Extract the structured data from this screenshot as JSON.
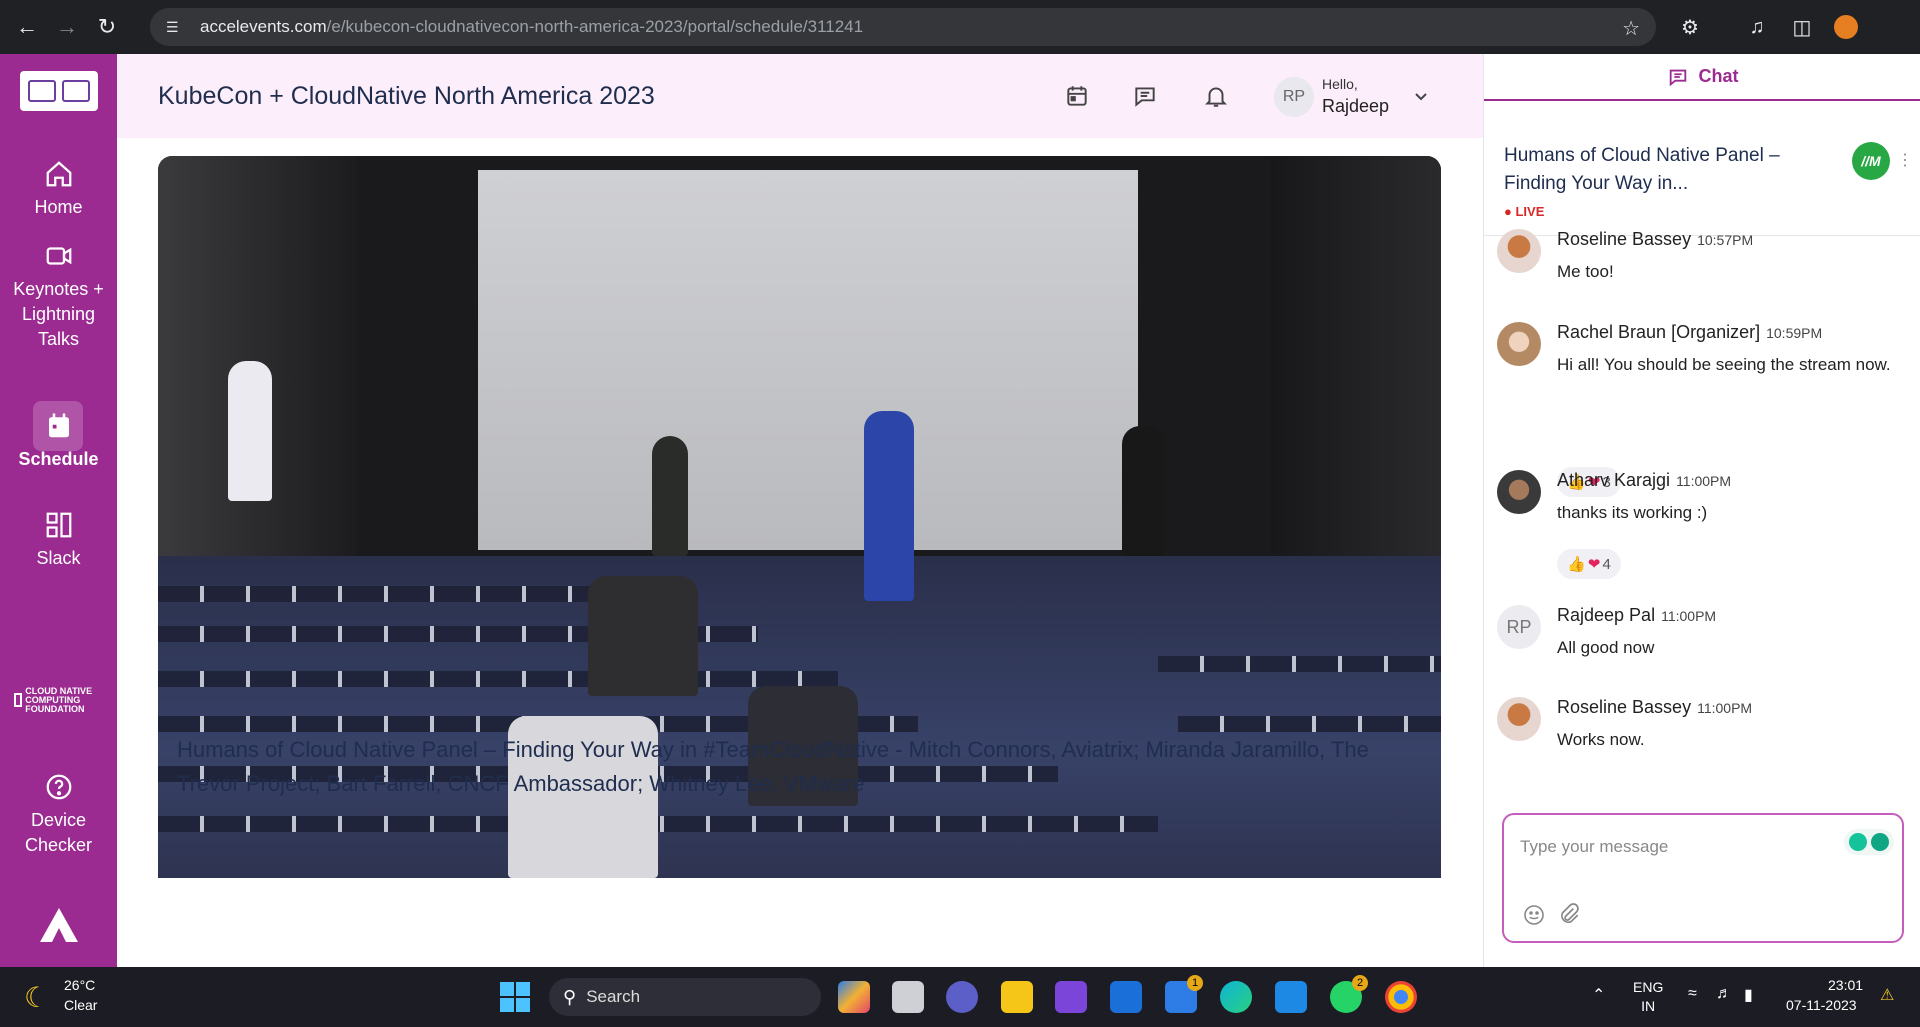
{
  "browser": {
    "url_host": "accelevents.com",
    "url_path": "/e/kubecon-cloudnativecon-north-america-2023/portal/schedule/311241"
  },
  "sidebar": {
    "items": [
      {
        "label": "Home"
      },
      {
        "label": "Keynotes + Lightning Talks"
      },
      {
        "label": "Schedule"
      },
      {
        "label": "Slack"
      },
      {
        "label": "Device Checker"
      }
    ],
    "cncf_logo": "CLOUD NATIVE COMPUTING FOUNDATION"
  },
  "header": {
    "title": "KubeCon + CloudNative North America 2023",
    "user_initials": "RP",
    "greeting": "Hello,",
    "user_name": "Rajdeep"
  },
  "video": {
    "title": "Humans of Cloud Native Panel – Finding Your Way in #TeamCloudNative - Mitch Connors, Aviatrix; Miranda Jaramillo, The Trevor Project; Bart Farrell, CNCF Ambassador; Whitney Lee, VMware"
  },
  "chat": {
    "tab_label": "Chat",
    "session_title": "Humans of Cloud Native Panel – Finding Your Way in...",
    "live_label": "LIVE",
    "badge": "//M",
    "messages": [
      {
        "name": "Roseline Bassey",
        "time": "10:57PM",
        "text": "Me too!",
        "avatar": "photo"
      },
      {
        "name": "Rachel Braun [Organizer]",
        "time": "10:59PM",
        "text": "Hi all! You should be seeing the stream now.",
        "avatar": "photo",
        "reaction_count": "3"
      },
      {
        "name": "Atharv Karajgi",
        "time": "11:00PM",
        "text": "thanks its working :)",
        "avatar": "photo",
        "reaction_count": "4"
      },
      {
        "name": "Rajdeep Pal",
        "time": "11:00PM",
        "text": "All good now",
        "avatar": "RP"
      },
      {
        "name": "Roseline Bassey",
        "time": "11:00PM",
        "text": "Works now.",
        "avatar": "photo"
      }
    ],
    "input_placeholder": "Type your message"
  },
  "taskbar": {
    "temperature": "26°C",
    "weather": "Clear",
    "search_label": "Search",
    "language": "ENG",
    "region": "IN",
    "time": "23:01",
    "date": "07-11-2023",
    "badges": {
      "todo": "1",
      "whatsapp": "2"
    }
  },
  "colors": {
    "sidebar": "#9b2a91",
    "header_bg": "#fdeefb",
    "live": "#d62828"
  }
}
